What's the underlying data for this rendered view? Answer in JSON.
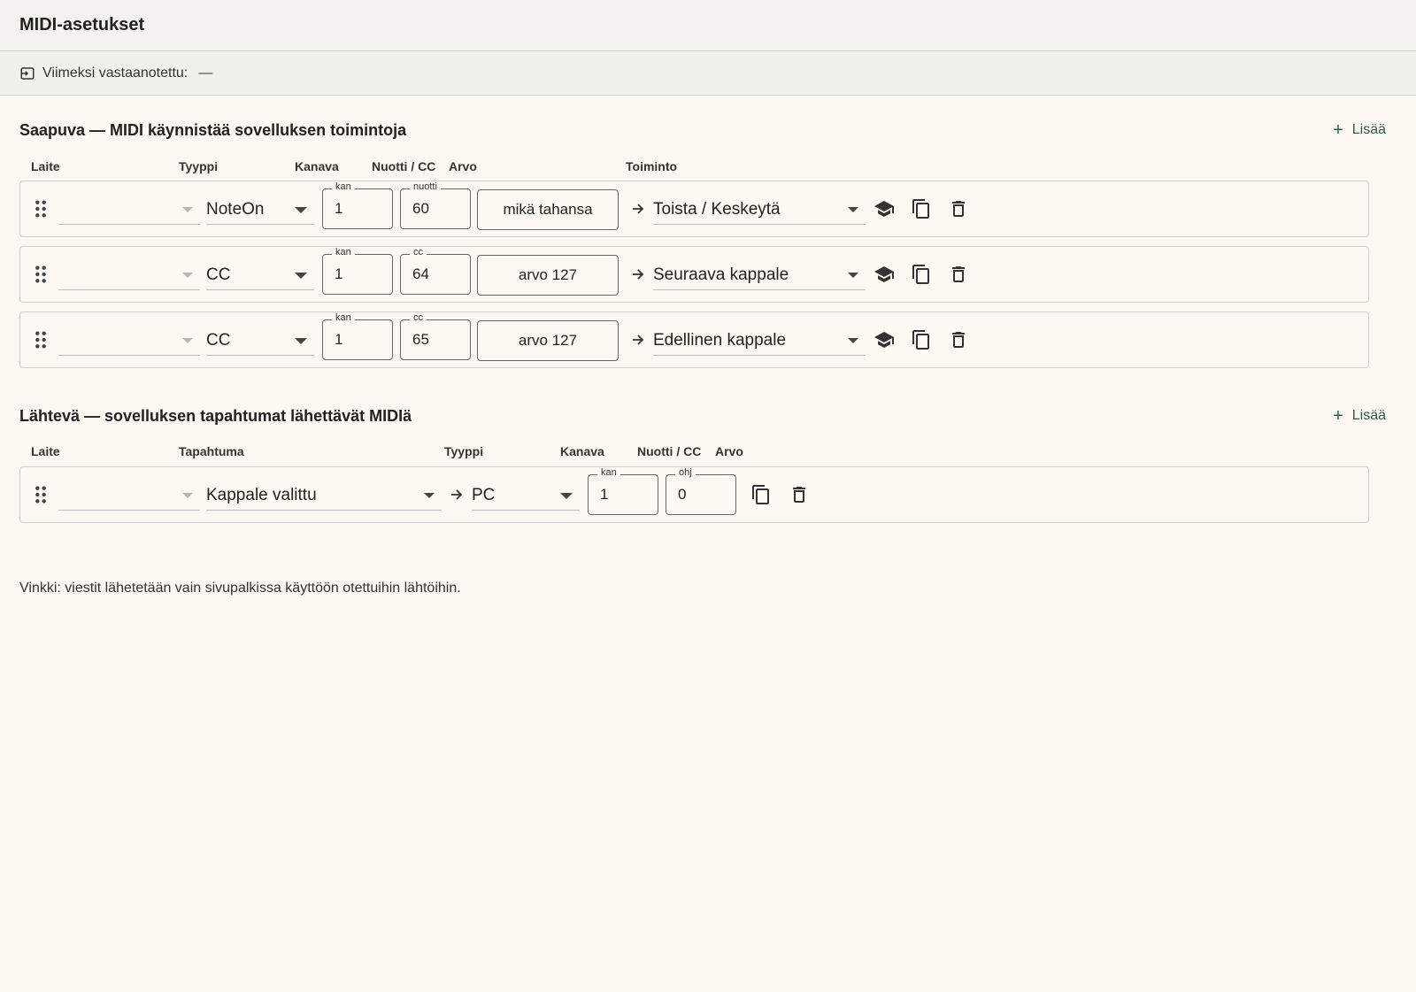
{
  "window": {
    "title": "MIDI-asetukset"
  },
  "status": {
    "label": "Viimeksi vastaanotettu:",
    "value": "—"
  },
  "incoming": {
    "title": "Saapuva — MIDI käynnistää sovelluksen toimintoja",
    "add_label": "Lisää",
    "columns": {
      "device": "Laite",
      "type": "Tyyppi",
      "channel": "Kanava",
      "note_cc": "Nuotti / CC",
      "value": "Arvo",
      "action": "Toiminto"
    },
    "rows": [
      {
        "device": "",
        "type": "NoteOn",
        "channel_label": "kan",
        "channel": "1",
        "num_label": "nuotti",
        "num": "60",
        "value": "mikä tahansa",
        "action": "Toista / Keskeytä"
      },
      {
        "device": "",
        "type": "CC",
        "channel_label": "kan",
        "channel": "1",
        "num_label": "cc",
        "num": "64",
        "value": "arvo 127",
        "action": "Seuraava kappale"
      },
      {
        "device": "",
        "type": "CC",
        "channel_label": "kan",
        "channel": "1",
        "num_label": "cc",
        "num": "65",
        "value": "arvo 127",
        "action": "Edellinen kappale"
      }
    ]
  },
  "outgoing": {
    "title": "Lähtevä — sovelluksen tapahtumat lähettävät MIDIä",
    "add_label": "Lisää",
    "columns": {
      "device": "Laite",
      "event": "Tapahtuma",
      "type": "Tyyppi",
      "channel": "Kanava",
      "note_cc": "Nuotti / CC",
      "value": "Arvo"
    },
    "rows": [
      {
        "device": "",
        "event": "Kappale valittu",
        "type": "PC",
        "channel_label": "kan",
        "channel": "1",
        "num_label": "ohj",
        "num": "0"
      }
    ]
  },
  "hint": "Vinkki: viestit lähetetään vain sivupalkissa käyttöön otettuihin lähtöihin.",
  "colors": {
    "accent": "#2e5e48",
    "background": "#fdf8f2",
    "border": "#cfcfcf"
  },
  "icons": {
    "learn": "school-icon",
    "duplicate": "copy-icon",
    "delete": "trash-icon",
    "drag": "drag-handle-icon",
    "status": "input-icon"
  }
}
